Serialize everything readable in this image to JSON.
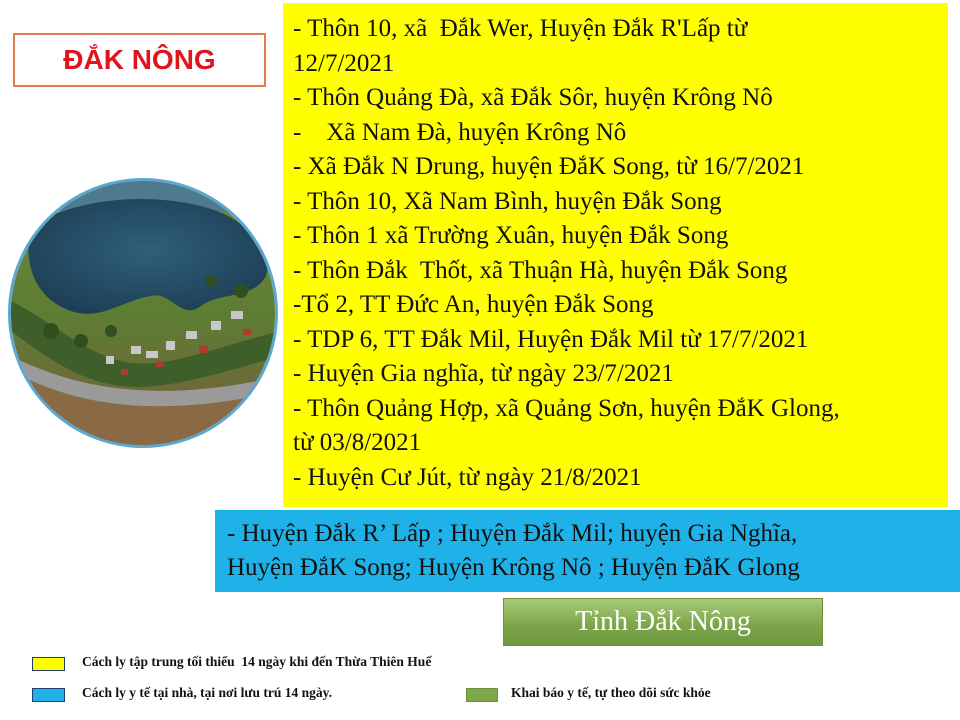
{
  "title": "ĐẮK NÔNG",
  "yellow_lines": [
    "- Thôn 10, xã  Đắk Wer, Huyện Đắk R'Lấp từ",
    "12/7/2021",
    "- Thôn Quảng Đà, xã Đắk Sôr, huyện Krông Nô",
    "-    Xã Nam Đà, huyện Krông Nô",
    "- Xã Đắk N Drung, huyện ĐắK Song, từ 16/7/2021",
    "- Thôn 10, Xã Nam Bình, huyện Đắk Song",
    "- Thôn 1 xã Trường Xuân, huyện Đắk Song",
    "- Thôn Đắk  Thốt, xã Thuận Hà, huyện Đắk Song",
    "-Tổ 2, TT Đức An, huyện Đắk Song",
    "- TDP 6, TT Đắk Mil, Huyện Đắk Mil từ 17/7/2021",
    "- Huyện Gia nghĩa, từ ngày 23/7/2021",
    "- Thôn Quảng Hợp, xã Quảng Sơn, huyện ĐắK Glong,",
    "từ 03/8/2021",
    "- Huyện Cư Jút, từ ngày 21/8/2021"
  ],
  "blue_lines": [
    "- Huyện Đắk R’ Lấp ; Huyện Đắk Mil; huyện Gia Nghĩa,",
    "Huyện ĐắK Song; Huyện Krông Nô ; Huyện ĐắK Glong"
  ],
  "province_button": "Tỉnh Đắk Nông",
  "legend": {
    "yellow": {
      "label": "Cách ly tập trung tối thiểu  14 ngày khi đến Thừa Thiên Huế",
      "color": "#ffff00"
    },
    "blue": {
      "label": "Cách ly y tế tại nhà, tại nơi lưu trú 14 ngày.",
      "color": "#1fb2e8"
    },
    "green": {
      "label": "Khai báo y tế, tự theo dõi sức khỏe",
      "color": "#7ea74a"
    }
  }
}
